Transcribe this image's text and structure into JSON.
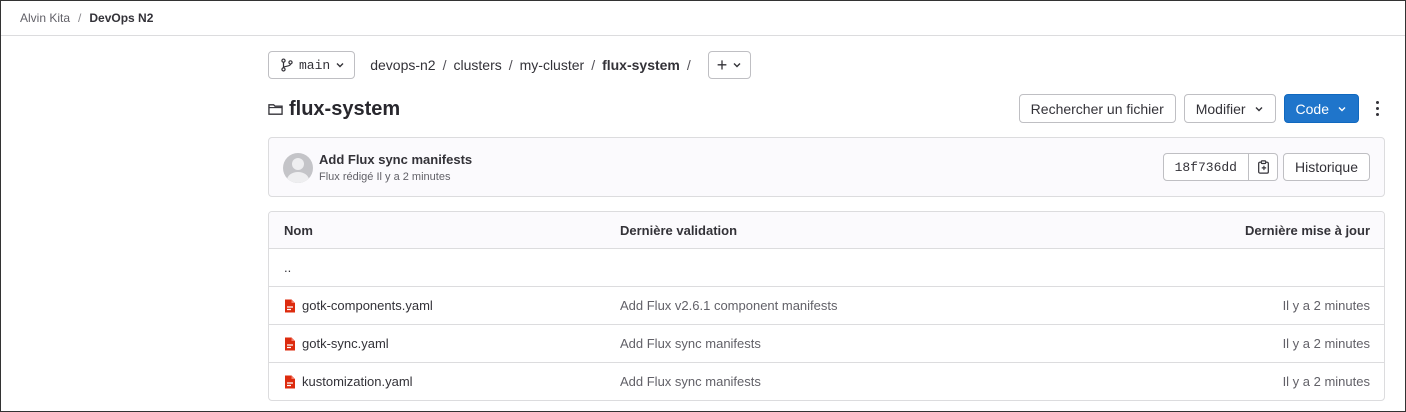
{
  "breadcrumb": {
    "items": [
      "Alvin Kita",
      "DevOps N2"
    ],
    "separator": "/"
  },
  "nav": {
    "branch": "main",
    "path": [
      "devops-n2",
      "clusters",
      "my-cluster",
      "flux-system"
    ],
    "separator": "/",
    "add_label": "+"
  },
  "page": {
    "title": "flux-system"
  },
  "actions": {
    "find_file": "Rechercher un fichier",
    "edit": "Modifier",
    "code": "Code"
  },
  "commit": {
    "title": "Add Flux sync manifests",
    "meta": "Flux rédigé Il y a 2 minutes",
    "sha": "18f736dd",
    "history": "Historique"
  },
  "table": {
    "headers": [
      "Nom",
      "Dernière validation",
      "Dernière mise à jour"
    ],
    "parent": "..",
    "rows": [
      {
        "name": "gotk-components.yaml",
        "commit": "Add Flux v2.6.1 component manifests",
        "updated": "Il y a 2 minutes"
      },
      {
        "name": "gotk-sync.yaml",
        "commit": "Add Flux sync manifests",
        "updated": "Il y a 2 minutes"
      },
      {
        "name": "kustomization.yaml",
        "commit": "Add Flux sync manifests",
        "updated": "Il y a 2 minutes"
      }
    ]
  },
  "colors": {
    "primary": "#1f75cb",
    "file_icon": "#dd2b0e",
    "border": "#dcdcde"
  }
}
